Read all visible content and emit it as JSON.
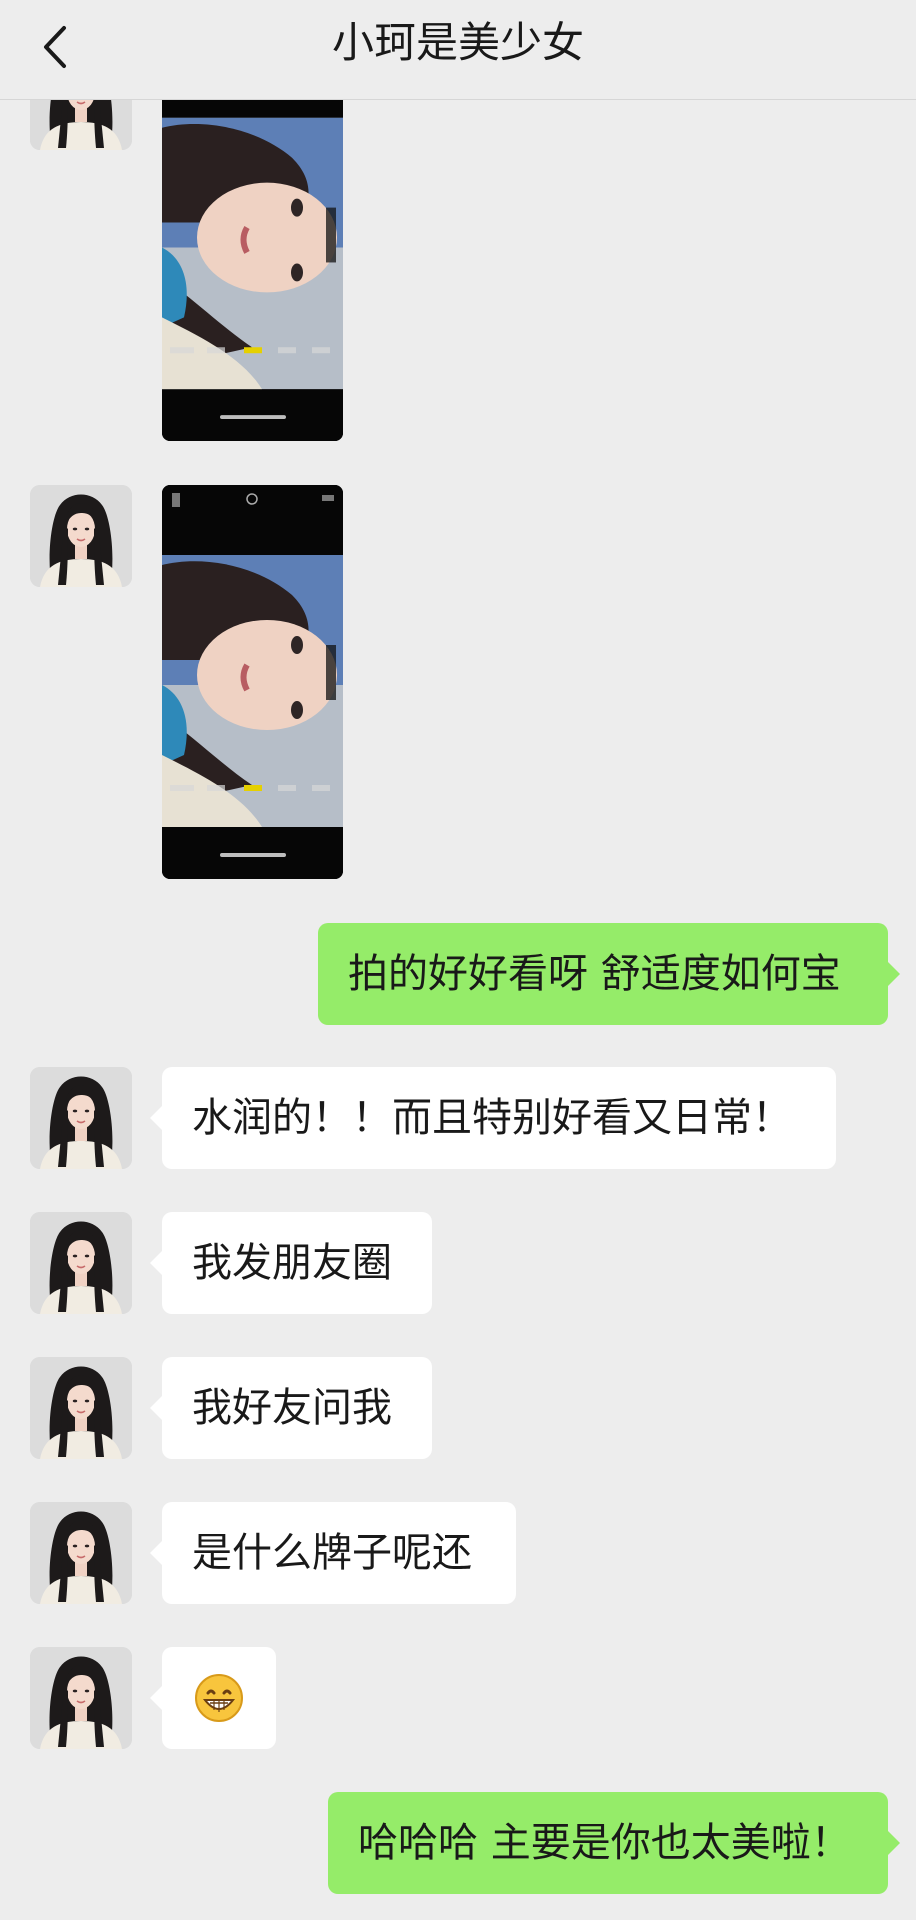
{
  "header": {
    "title": "小珂是美少女"
  },
  "messages": [
    {
      "sender": "contact",
      "type": "image"
    },
    {
      "sender": "contact",
      "type": "image"
    },
    {
      "sender": "me",
      "type": "text",
      "text": "拍的好好看呀 舒适度如何宝"
    },
    {
      "sender": "contact",
      "type": "text",
      "text": "水润的！！而且特别好看又日常！"
    },
    {
      "sender": "contact",
      "type": "text",
      "text": "我发朋友圈"
    },
    {
      "sender": "contact",
      "type": "text",
      "text": "我好友问我"
    },
    {
      "sender": "contact",
      "type": "text",
      "text": "是什么牌子呢还"
    },
    {
      "sender": "contact",
      "type": "emoji",
      "icon": "grinning-face-icon"
    },
    {
      "sender": "me",
      "type": "text",
      "text": "哈哈哈 主要是你也太美啦！"
    }
  ],
  "colors": {
    "background": "#ededed",
    "outgoing_bubble": "#95ec69",
    "incoming_bubble": "#ffffff"
  }
}
